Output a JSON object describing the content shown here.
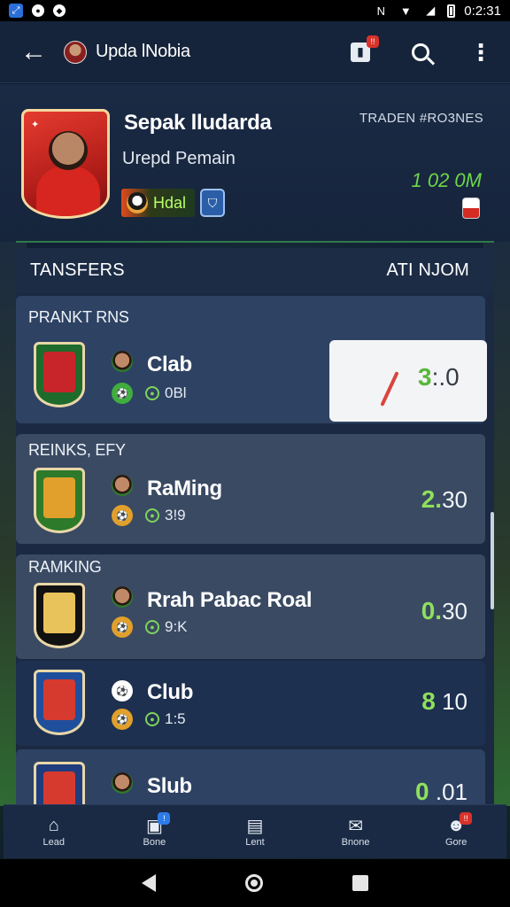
{
  "status_bar": {
    "time": "0:2:31",
    "icons_left": [
      "app-icon",
      "notification-icon",
      "location-icon"
    ],
    "icons_right": [
      "nfc-icon",
      "wifi-icon",
      "signal-icon",
      "battery-icon"
    ]
  },
  "app_bar": {
    "title": "Upda lNobia",
    "badge": "!!"
  },
  "profile": {
    "name": "Sepak lludarda",
    "subtitle": "Urepd Pemain",
    "medal_label": "Hdal",
    "right_label": "TRADEN #RO3NES",
    "value": "1 02 0M"
  },
  "transfers": {
    "title": "TANSFERS",
    "action": "ATI NJOM",
    "cards": [
      {
        "label": "PRANKT RNS",
        "title": "Clab",
        "meta": "0Bl",
        "value_highlight": "3",
        "value_rest": ":.0",
        "crest_colors": [
          "#1f6b2b",
          "#c8252a"
        ]
      },
      {
        "label": "REINKS, EFY",
        "title": "RaMing",
        "meta": "3!9",
        "value_highlight": "2.",
        "value_rest": "30",
        "crest_colors": [
          "#2d7a2a",
          "#e0a02b"
        ]
      },
      {
        "label": "RAMKING",
        "title": "Rrah Pabac Roal",
        "meta": "9:K",
        "value_highlight": "0.",
        "value_rest": "30",
        "crest_colors": [
          "#111111",
          "#e8c25a"
        ]
      },
      {
        "label": "",
        "title": "Club",
        "meta": "1:5",
        "value_highlight": "8",
        "value_rest": "10",
        "crest_colors": [
          "#1f4f9c",
          "#d63a2f"
        ]
      },
      {
        "label": "",
        "title": "Slub",
        "meta": "",
        "value_highlight": "0",
        "value_rest": ".01",
        "crest_colors": [
          "#1f3c7c",
          "#d63a2f"
        ]
      }
    ]
  },
  "bottom_nav": {
    "items": [
      {
        "label": "Lead",
        "icon": "home-icon"
      },
      {
        "label": "Bone",
        "icon": "store-icon",
        "badge": "!"
      },
      {
        "label": "Lent",
        "icon": "building-icon"
      },
      {
        "label": "Bnone",
        "icon": "mail-icon"
      },
      {
        "label": "Gore",
        "icon": "profile-icon",
        "badge": "!!"
      }
    ]
  }
}
